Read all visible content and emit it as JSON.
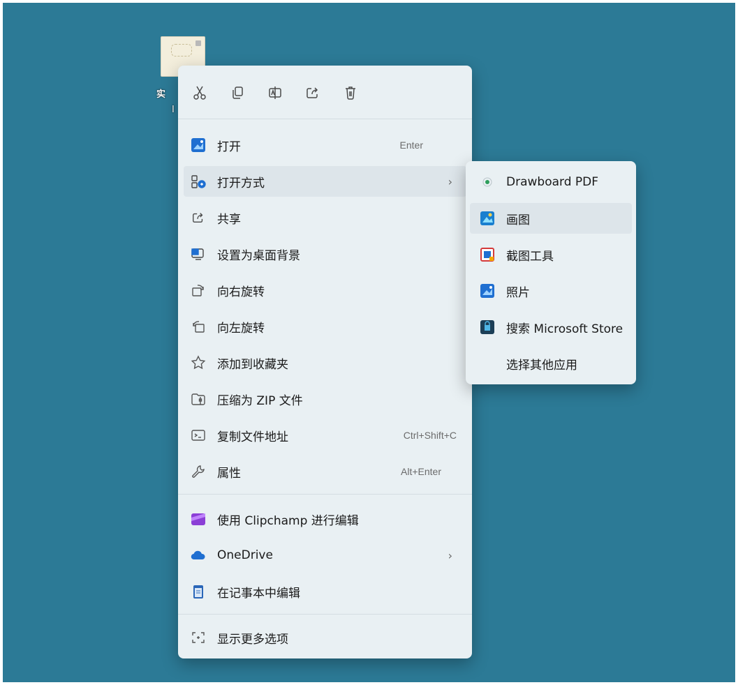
{
  "colors": {
    "desktop": "#2c7a96",
    "menu_bg": "#e9f0f3",
    "hover_bg": "#dde5ea",
    "text": "#1a1a1a",
    "shortcut_text": "#6b6b6b"
  },
  "desktop": {
    "file_label_fragment_1": "实",
    "file_label_fragment_2": "I"
  },
  "toolbar": {
    "buttons": [
      {
        "icon": "cut-icon"
      },
      {
        "icon": "copy-icon"
      },
      {
        "icon": "rename-icon"
      },
      {
        "icon": "share-icon"
      },
      {
        "icon": "delete-icon"
      }
    ]
  },
  "menu": {
    "items": [
      {
        "label": "打开",
        "shortcut": "Enter",
        "icon": "photos-app-icon"
      },
      {
        "label": "打开方式",
        "icon": "open-with-icon",
        "has_submenu": true
      },
      {
        "label": "共享",
        "icon": "share-icon"
      },
      {
        "label": "设置为桌面背景",
        "icon": "set-background-icon"
      },
      {
        "label": "向右旋转",
        "icon": "rotate-right-icon"
      },
      {
        "label": "向左旋转",
        "icon": "rotate-left-icon"
      },
      {
        "label": "添加到收藏夹",
        "icon": "star-icon"
      },
      {
        "label": "压缩为 ZIP 文件",
        "icon": "zip-folder-icon"
      },
      {
        "label": "复制文件地址",
        "shortcut": "Ctrl+Shift+C",
        "icon": "copy-path-icon"
      },
      {
        "label": "属性",
        "shortcut": "Alt+Enter",
        "icon": "wrench-icon"
      },
      {
        "label": "使用 Clipchamp 进行编辑",
        "icon": "clipchamp-icon"
      },
      {
        "label": "OneDrive",
        "icon": "onedrive-cloud-icon",
        "has_submenu": true
      },
      {
        "label": "在记事本中编辑",
        "icon": "notepad-icon"
      },
      {
        "label": "显示更多选项",
        "icon": "more-options-icon"
      }
    ],
    "chevron": "›"
  },
  "submenu": {
    "items": [
      {
        "label": "Drawboard PDF",
        "icon": "drawboard-pdf-icon"
      },
      {
        "label": "画图",
        "icon": "paint-app-icon"
      },
      {
        "label": "截图工具",
        "icon": "snipping-tool-icon"
      },
      {
        "label": "照片",
        "icon": "photos-app-icon"
      },
      {
        "label": "搜索 Microsoft Store",
        "icon": "microsoft-store-icon"
      },
      {
        "label": "选择其他应用",
        "icon": ""
      }
    ]
  }
}
